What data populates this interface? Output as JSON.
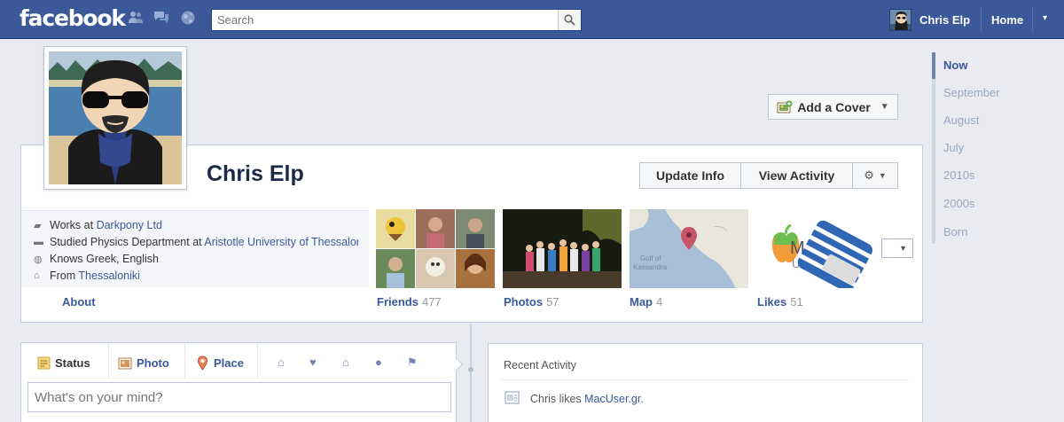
{
  "topbar": {
    "logo": "facebook",
    "search_placeholder": "Search",
    "user_name": "Chris Elp",
    "home_label": "Home",
    "menu_arrow": "▾",
    "brand_color": "#3b5998"
  },
  "profile": {
    "name": "Chris Elp",
    "add_cover_label": "Add a Cover",
    "update_info_label": "Update Info",
    "view_activity_label": "View Activity",
    "info": [
      {
        "prefix": "Works at ",
        "link": "Darkpony Ltd",
        "suffix": ""
      },
      {
        "prefix": "Studied Physics Department at ",
        "link": "Aristotle University of Thessaloniki",
        "suffix": ""
      },
      {
        "prefix": "Knows Greek, English",
        "link": "",
        "suffix": ""
      },
      {
        "prefix": "From ",
        "link": "Thessaloniki",
        "suffix": ""
      }
    ],
    "about_label": "About"
  },
  "thumbnails": [
    {
      "label": "Friends",
      "count": "477"
    },
    {
      "label": "Photos",
      "count": "57"
    },
    {
      "label": "Map",
      "count": "4"
    },
    {
      "label": "Likes",
      "count": "51"
    }
  ],
  "map_text": [
    "Gulf of",
    "Kassandra"
  ],
  "likes_text": "MA",
  "likes_text_2": "Use",
  "timeline": {
    "items": [
      "Now",
      "September",
      "August",
      "July",
      "2010s",
      "2000s",
      "Born"
    ],
    "active_index": 0
  },
  "composer": {
    "tabs": [
      "Status",
      "Photo",
      "Place"
    ],
    "placeholder": "What's on your mind?"
  },
  "recent_activity": {
    "title": "Recent Activity",
    "item_prefix": "Chris likes ",
    "item_link": "MacUser.gr."
  }
}
